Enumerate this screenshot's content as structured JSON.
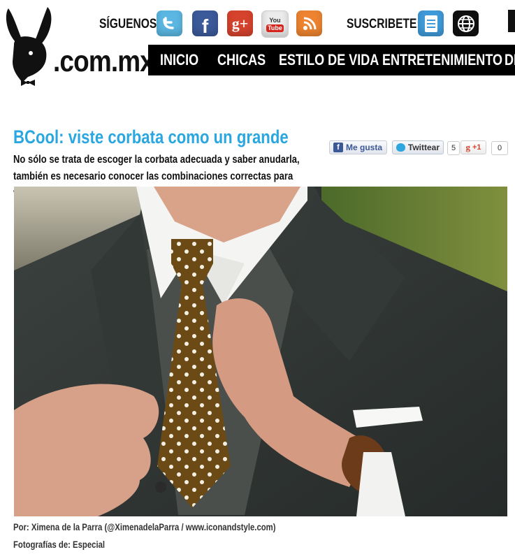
{
  "header": {
    "logo_text": ".com.mx",
    "follow_label": "SÍGUENOS:",
    "subscribe_label": "SUSCRIBETE:",
    "social_icons": [
      "twitter-icon",
      "facebook-icon",
      "google-plus-icon",
      "youtube-icon",
      "rss-icon"
    ],
    "subscribe_icons": [
      "document-icon",
      "globe-icon"
    ]
  },
  "nav": {
    "items": [
      "INICIO",
      "CHICAS",
      "ESTILO DE VIDA",
      "ENTRETENIMIENTO",
      "DI"
    ]
  },
  "article": {
    "title": "BCool: viste corbata como un grande",
    "lead": "No sólo se trata de escoger la corbata adecuada y saber anudarla, también es necesario conocer las combinaciones correctas para verse bien…",
    "author_credit": "Por: Ximena de la Parra (@XimenadelaParra / www.iconandstyle.com)",
    "photo_credit": "Fotografías de: Especial"
  },
  "share": {
    "fb_like": "Me gusta",
    "tweet": "Twittear",
    "tweet_count": "5",
    "gplus_label": "+1",
    "gplus_count": "0"
  },
  "colors": {
    "title_accent": "#2aa7e0",
    "nav_bg": "#000000",
    "twitter": "#5bb7e2",
    "facebook": "#3b5a9a",
    "google_plus": "#d6432d",
    "rss": "#ee8430"
  }
}
